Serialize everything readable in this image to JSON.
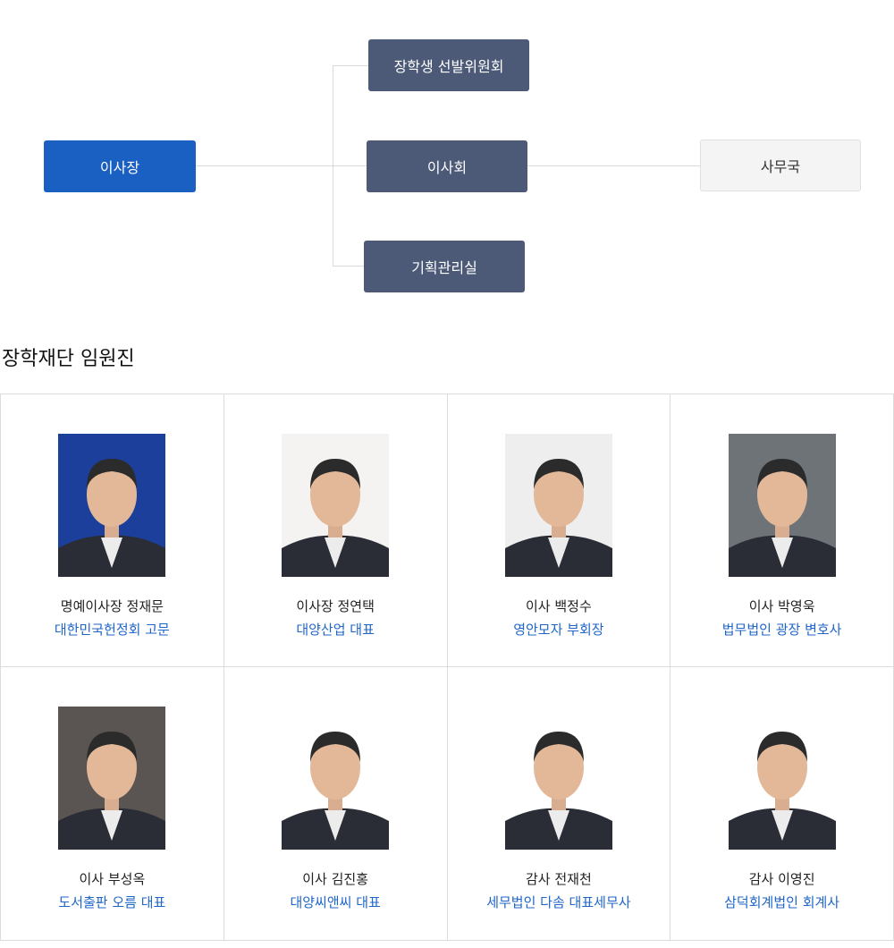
{
  "org_chart": {
    "chairman": "이사장",
    "committee": "장학생 선발위원회",
    "board": "이사회",
    "planning": "기획관리실",
    "office": "사무국"
  },
  "section": {
    "title": "장학재단 임원진"
  },
  "members": [
    {
      "name": "명예이사장 정재문",
      "org": "대한민국헌정회 고문",
      "bg": "#1c3f9c"
    },
    {
      "name": "이사장 정연택",
      "org": "대양산업 대표",
      "bg": "#f5f2f2"
    },
    {
      "name": "이사 백정수",
      "org": "영안모자 부회장",
      "bg": "#eeeeee"
    },
    {
      "name": "이사 박영욱",
      "org": "법무법인 광장 변호사",
      "bg": "#6e7378"
    },
    {
      "name": "이사 부성옥",
      "org": "도서출판 오름 대표",
      "bg": "#5a5552"
    },
    {
      "name": "이사 김진홍",
      "org": "대양씨앤씨 대표",
      "bg": "#ffffff"
    },
    {
      "name": "감사 전재천",
      "org": "세무법인 다솜 대표세무사",
      "bg": "#ffffff"
    },
    {
      "name": "감사 이영진",
      "org": "삼덕회계법인 회계사",
      "bg": "#ffffff"
    }
  ]
}
